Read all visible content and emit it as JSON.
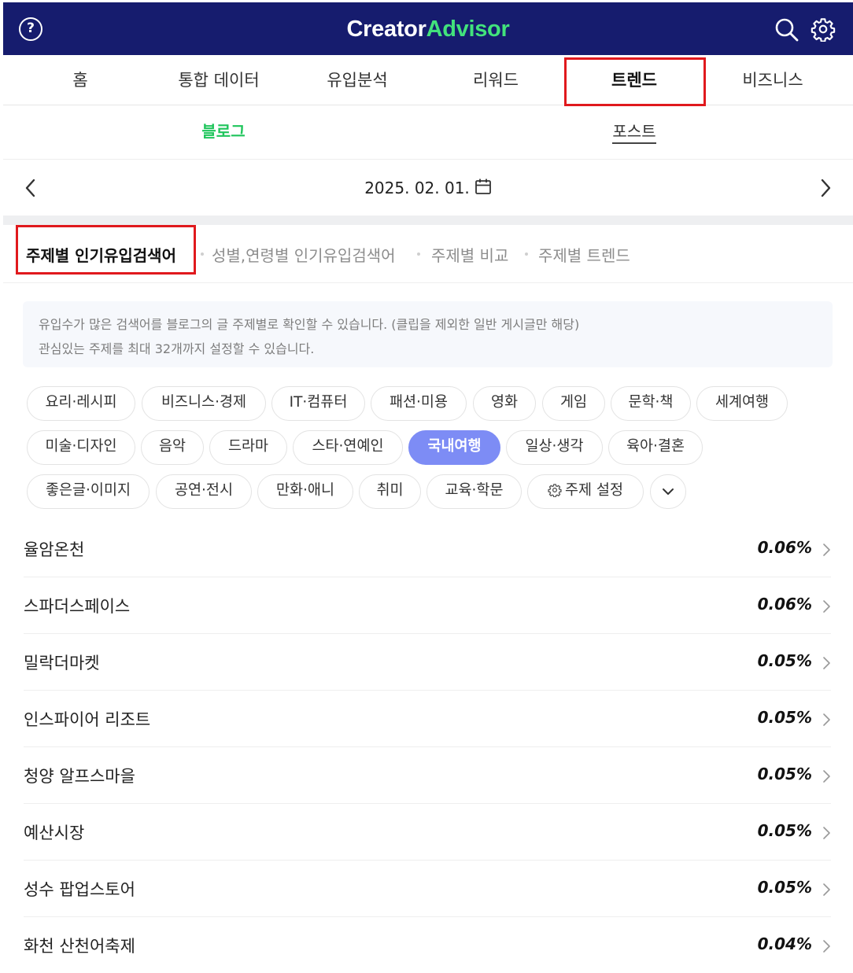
{
  "header": {
    "help_icon": "help-circle-icon",
    "logo_part1": "Creator",
    "logo_part2": "Advisor",
    "brand_green": "#42e27c",
    "bar_color": "#161c6e",
    "search_icon": "search-icon",
    "settings_icon": "gear-icon"
  },
  "main_tabs": [
    {
      "label": "홈"
    },
    {
      "label": "통합 데이터"
    },
    {
      "label": "유입분석"
    },
    {
      "label": "리워드"
    },
    {
      "label": "트렌드",
      "active": true
    },
    {
      "label": "비즈니스"
    }
  ],
  "sub_tabs": {
    "blog": "블로그",
    "post": "포스트"
  },
  "date_nav": {
    "date": "2025. 02. 01."
  },
  "section_tabs": [
    {
      "label": "주제별 인기유입검색어",
      "active": true
    },
    {
      "label": "성별,연령별 인기유입검색어"
    },
    {
      "label": "주제별 비교"
    },
    {
      "label": "주제별 트렌드"
    }
  ],
  "info": {
    "line1": "유입수가 많은 검색어를 블로그의 글 주제별로 확인할 수 있습니다. (클립을 제외한 일반 게시글만 해당)",
    "line2": "관심있는 주제를 최대 32개까지 설정할 수 있습니다."
  },
  "topics": [
    {
      "label": "요리·레시피"
    },
    {
      "label": "비즈니스·경제"
    },
    {
      "label": "IT·컴퓨터"
    },
    {
      "label": "패션·미용"
    },
    {
      "label": "영화"
    },
    {
      "label": "게임"
    },
    {
      "label": "문학·책"
    },
    {
      "label": "세계여행"
    },
    {
      "label": "미술·디자인"
    },
    {
      "label": "음악"
    },
    {
      "label": "드라마"
    },
    {
      "label": "스타·연예인"
    },
    {
      "label": "국내여행",
      "selected": true
    },
    {
      "label": "일상·생각"
    },
    {
      "label": "육아·결혼"
    },
    {
      "label": "좋은글·이미지"
    },
    {
      "label": "공연·전시"
    },
    {
      "label": "만화·애니"
    },
    {
      "label": "취미"
    },
    {
      "label": "교육·학문"
    }
  ],
  "topic_settings_label": "주제 설정",
  "selected_chip_color": "#7d8cf5",
  "keywords": [
    {
      "keyword": "율암온천",
      "share": "0.06%"
    },
    {
      "keyword": "스파더스페이스",
      "share": "0.06%"
    },
    {
      "keyword": "밀락더마켓",
      "share": "0.05%"
    },
    {
      "keyword": "인스파이어 리조트",
      "share": "0.05%"
    },
    {
      "keyword": "청양 알프스마을",
      "share": "0.05%"
    },
    {
      "keyword": "예산시장",
      "share": "0.05%"
    },
    {
      "keyword": "성수 팝업스토어",
      "share": "0.05%"
    },
    {
      "keyword": "화천 산천어축제",
      "share": "0.04%"
    }
  ]
}
